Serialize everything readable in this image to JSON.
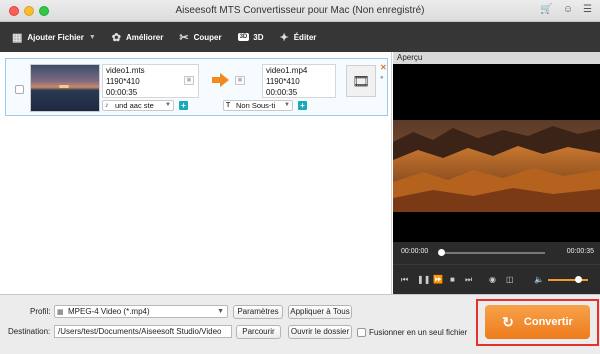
{
  "window": {
    "title": "Aiseesoft MTS Convertisseur pour Mac (Non enregistré)",
    "icons": [
      "cart-icon",
      "user-icon",
      "menu-icon"
    ]
  },
  "toolbar": {
    "add_file": "Ajouter Fichier",
    "enhance": "Améliorer",
    "cut": "Couper",
    "three_d_badge": "3D",
    "three_d": "3D",
    "edit": "Éditer"
  },
  "file": {
    "source": {
      "name": "video1.mts",
      "resolution": "1190*410",
      "duration": "00:00:35"
    },
    "output": {
      "name": "video1.mp4",
      "resolution": "1190*410",
      "duration": "00:00:35"
    },
    "audio_track": "und aac ste",
    "subtitle": "Non Sous-ti",
    "subtitle_icon_text": "T"
  },
  "preview": {
    "label": "Aperçu",
    "time_current": "00:00:00",
    "time_total": "00:00:35",
    "progress": 0,
    "volume": 0.75
  },
  "bottom": {
    "profile_label": "Profil:",
    "profile_value": "MPEG-4 Video (*.mp4)",
    "settings": "Paramètres",
    "apply_all": "Appliquer à Tous",
    "destination_label": "Destination:",
    "destination_value": "/Users/test/Documents/Aiseesoft Studio/Video",
    "browse": "Parcourir",
    "open_folder": "Ouvrir le dossier",
    "merge_label": "Fusionner en un seul fichier",
    "convert": "Convertir"
  },
  "colors": {
    "accent": "#f08a1c",
    "highlight_outline": "#e8312b",
    "toolbar_bg": "#363636",
    "plus_teal": "#19a9b8"
  }
}
